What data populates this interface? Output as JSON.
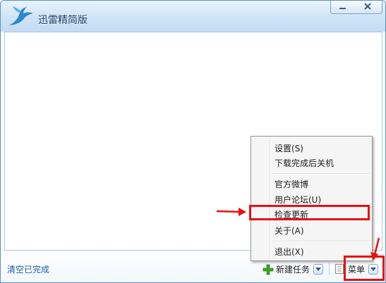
{
  "window": {
    "title": "迅雷精简版"
  },
  "bottom": {
    "clear_label": "清空已完成",
    "new_task_label": "新建任务",
    "menu_label": "菜单"
  },
  "menu": {
    "items": [
      "设置(S)",
      "下载完成后关机",
      "官方微博",
      "用户论坛(U)",
      "检查更新",
      "关于(A)",
      "退出(X)"
    ],
    "highlighted": "检查更新"
  },
  "colors": {
    "accent": "#e81010",
    "link": "#1f5fa6",
    "plus": "#3aa51e"
  },
  "icons": [
    "bird-logo-icon",
    "minimize-icon",
    "close-icon",
    "plus-icon",
    "chevron-down-icon",
    "document-icon"
  ]
}
